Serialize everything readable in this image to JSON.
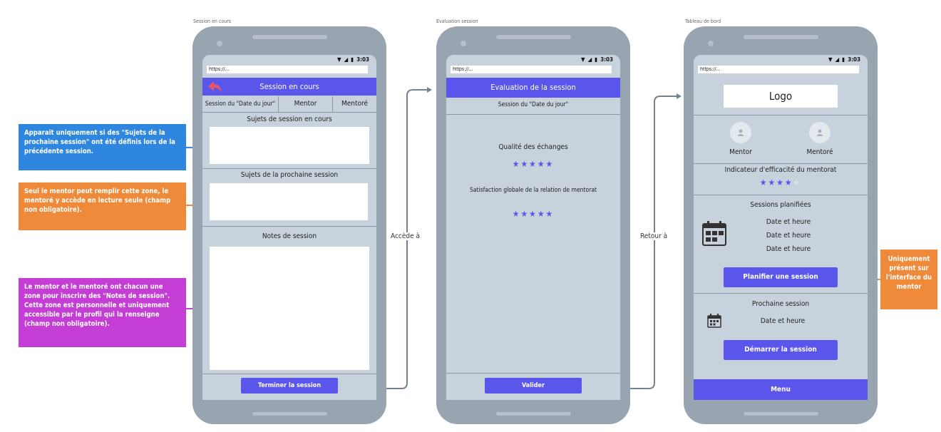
{
  "frames": {
    "f1_label": "Session en cours",
    "f2_label": "Evaluation session",
    "f3_label": "Tableau de bord"
  },
  "status": {
    "time": "3:03",
    "url": "https://..."
  },
  "screen1": {
    "header": "Session en cours",
    "tabs": [
      "Session du \"Date du jour\"",
      "Mentor",
      "Mentoré"
    ],
    "section1": "Sujets de session en cours",
    "section2": "Sujets de la prochaine session",
    "section3": "Notes de session",
    "end_button": "Terminer la session"
  },
  "screen2": {
    "header": "Evaluation de la session",
    "subtitle": "Session du \"Date du jour\"",
    "rating1_label": "Qualité des échanges",
    "rating1_stars": "★★★★★",
    "rating2_label": "Satisfaction globale de la relation de mentorat",
    "rating2_stars": "★★★★★",
    "submit_button": "Valider"
  },
  "screen3": {
    "logo": "Logo",
    "mentor": "Mentor",
    "mentee": "Mentoré",
    "indicator_label": "Indicateur d'efficacité du mentorat",
    "indicator_stars_filled": "★★★★",
    "indicator_stars_empty": "★",
    "planned_title": "Sessions planifiées",
    "planned_dates": [
      "Date et heure",
      "Date et heure",
      "Date et heure"
    ],
    "plan_button": "Planifier une session",
    "next_title": "Prochaine session",
    "next_date": "Date et heure",
    "start_button": "Démarrer la session",
    "menu": "Menu"
  },
  "connectors": {
    "c1": "Accède à",
    "c2": "Retour à"
  },
  "notes": {
    "blue": "Apparait uniquement si des \"Sujets de la prochaine session\" ont été définis lors de la précédente session.",
    "orange": "Seul le mentor peut remplir cette zone, le mentoré y accède en lecture seule (champ non obligatoire).",
    "purple": "Le mentor et le mentoré ont chacun une zone pour inscrire des \"Notes de session\". Cette zone est personnelle et uniquement accessible par le profil qui la renseigne (champ non obligatoire).",
    "right": "Uniquement présent sur l'interface du mentor"
  },
  "colors": {
    "accent": "#5b56eb",
    "blue": "#2e86de",
    "orange": "#ef8a3a",
    "purple": "#c43ed6",
    "back_arrow": "#e0566b"
  }
}
